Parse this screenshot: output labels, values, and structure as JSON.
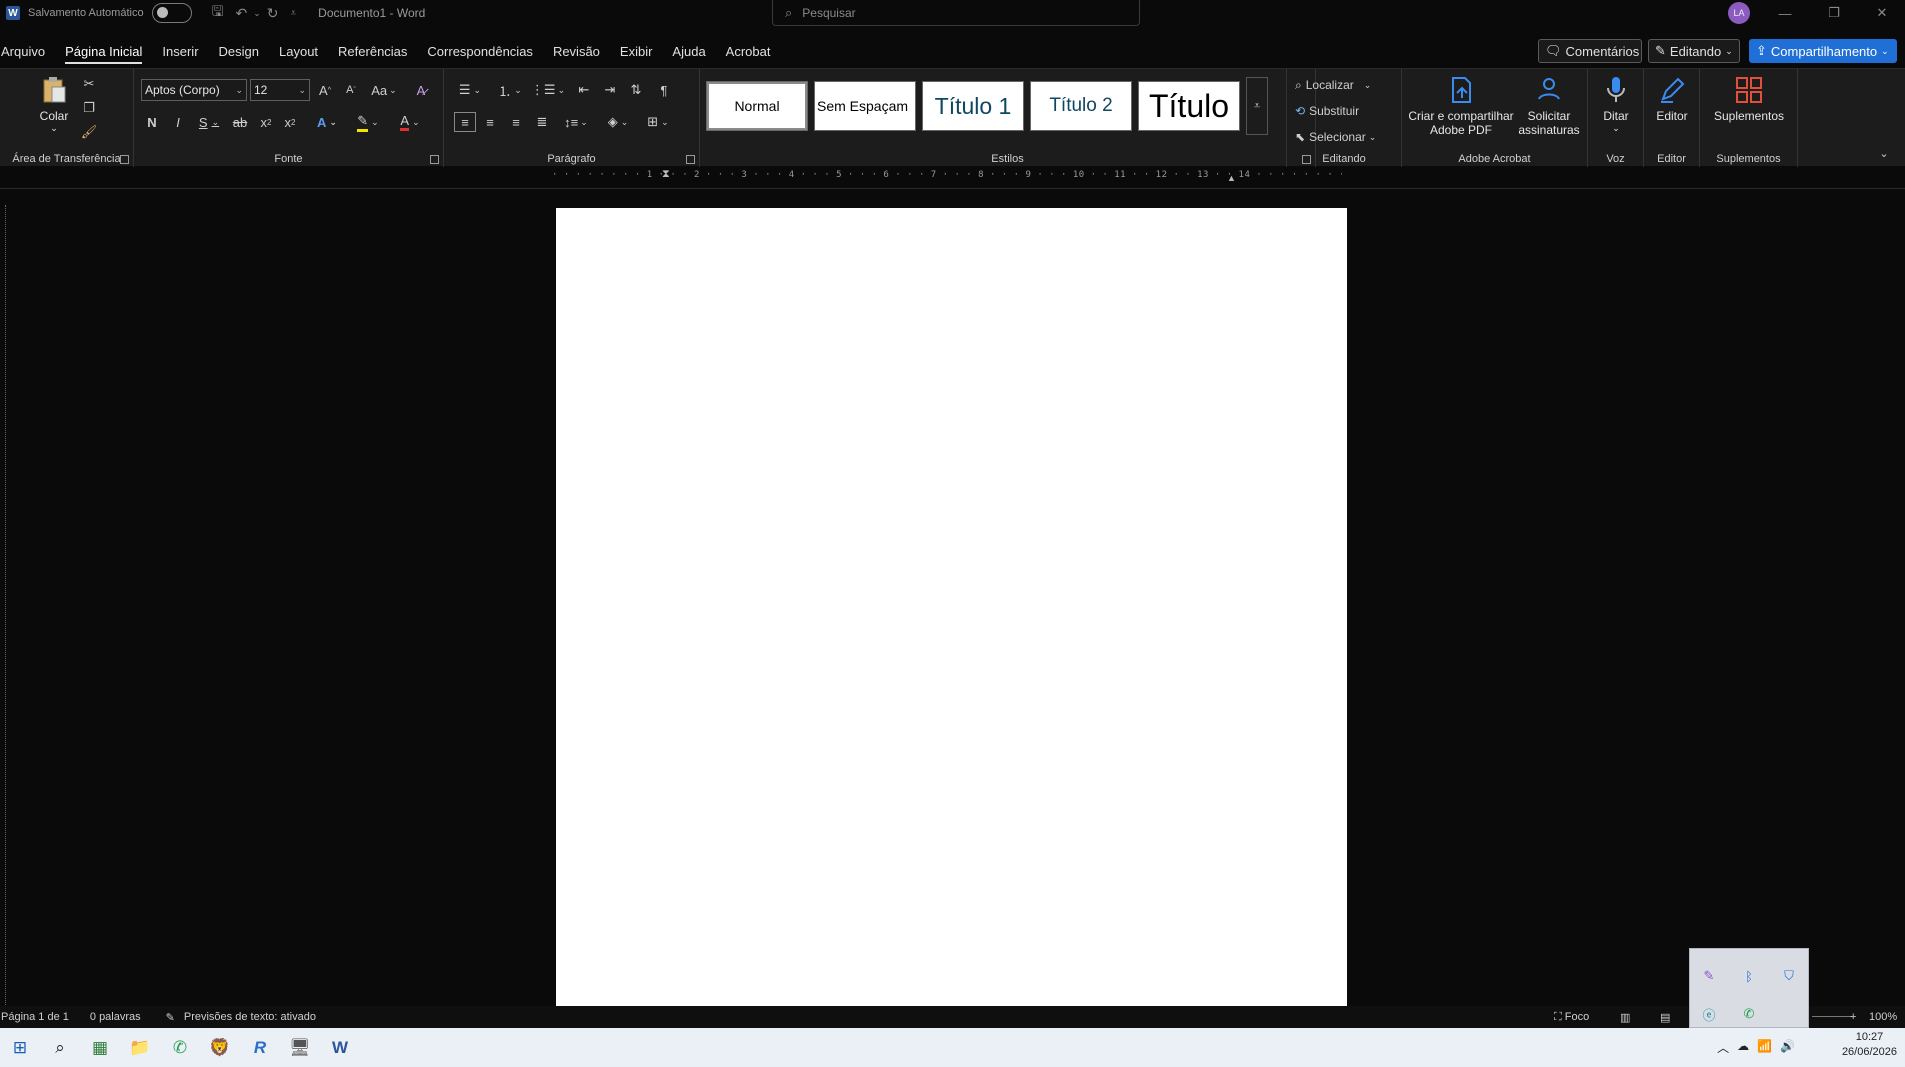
{
  "titlebar": {
    "autosave_label": "Salvamento Automático",
    "doc_title": "Documento1 - Word",
    "search_placeholder": "Pesquisar",
    "avatar_initials": "LA"
  },
  "tabs": [
    {
      "label": "Arquivo"
    },
    {
      "label": "Página Inicial"
    },
    {
      "label": "Inserir"
    },
    {
      "label": "Design"
    },
    {
      "label": "Layout"
    },
    {
      "label": "Referências"
    },
    {
      "label": "Correspondências"
    },
    {
      "label": "Revisão"
    },
    {
      "label": "Exibir"
    },
    {
      "label": "Ajuda"
    },
    {
      "label": "Acrobat"
    }
  ],
  "right_buttons": {
    "comments": "Comentários",
    "editing": "Editando",
    "share": "Compartilhamento"
  },
  "ribbon": {
    "clipboard": {
      "paste_label": "Colar",
      "group_label": "Área de Transferência"
    },
    "font": {
      "font_name": "Aptos (Corpo)",
      "font_size": "12",
      "group_label": "Fonte",
      "change_case": "Aa"
    },
    "paragraph": {
      "group_label": "Parágrafo"
    },
    "styles": {
      "group_label": "Estilos",
      "items": [
        {
          "label": "Normal"
        },
        {
          "label": "Sem Espaçam"
        },
        {
          "label": "Título 1"
        },
        {
          "label": "Título 2"
        },
        {
          "label": "Título"
        }
      ]
    },
    "editing": {
      "find": "Localizar",
      "replace": "Substituir",
      "select": "Selecionar",
      "group_label": "Editando"
    },
    "acrobat": {
      "create_share_line1": "Criar e compartilhar",
      "create_share_line2": "Adobe PDF",
      "request_line1": "Solicitar",
      "request_line2": "assinaturas",
      "group_label": "Adobe Acrobat"
    },
    "voice": {
      "dictate": "Ditar",
      "group_label": "Voz"
    },
    "editor": {
      "label": "Editor",
      "group_label": "Editor"
    },
    "addins": {
      "label": "Suplementos",
      "group_label": "Suplementos"
    }
  },
  "ruler": {
    "text": "· · · · · · · · 1 · · · 2 · · · 3 · · · 4 · · · 5 · · · 6 · · · 7 · · · 8 · · · 9 · · · 10 · · 11 · · 12 · · 13 · · 14 · · · · · · · ·"
  },
  "statusbar": {
    "page": "Página 1 de 1",
    "words": "0 palavras",
    "text_predictions": "Previsões de texto: ativado",
    "focus": "Foco",
    "zoom": "100%"
  },
  "taskbar": {
    "time": "10:27",
    "date": "26/06/2026"
  },
  "colors": {
    "accent_blue": "#1f6fd6",
    "ribbon_bg": "#1c1c1c",
    "page_bg": "#ffffff",
    "taskbar_bg": "#eaf0f6"
  }
}
